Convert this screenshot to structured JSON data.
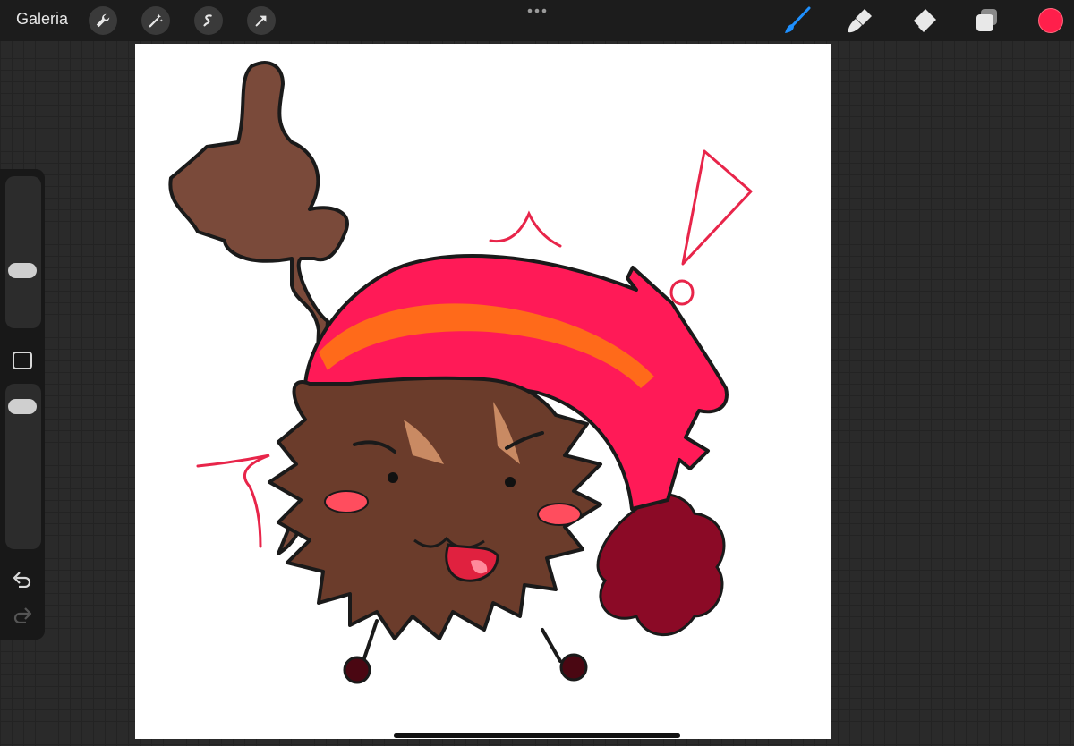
{
  "topbar": {
    "gallery_label": "Galeria",
    "left_tools": [
      "actions-wrench-icon",
      "adjustments-wand-icon",
      "selection-icon",
      "transform-arrow-icon"
    ],
    "more_icon": "more-dots-icon",
    "right_tools": [
      "brush-icon",
      "smudge-icon",
      "eraser-icon",
      "layers-icon"
    ],
    "active_tool": "brush",
    "current_color": "#ff1f4b"
  },
  "sidebar": {
    "brush_size_level": 0.55,
    "opacity_level": 0.9,
    "modify_icon": "square-icon",
    "undo_icon": "undo-icon",
    "redo_icon": "redo-icon"
  },
  "canvas": {
    "background": "#ffffff",
    "artwork": "hand-drawn-character-illustration"
  }
}
